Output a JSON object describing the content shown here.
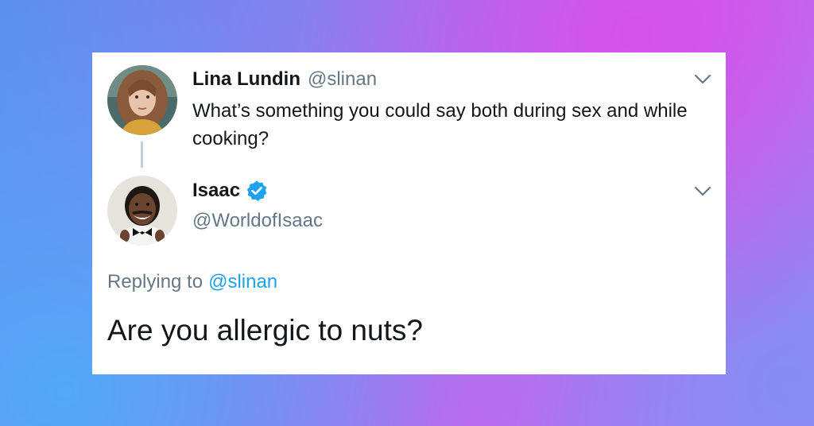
{
  "original_tweet": {
    "display_name": "Lina Lundin",
    "handle": "@slinan",
    "text": "What’s something you could say both during sex and while cooking?",
    "avatar_icon": "woman-portrait-avatar",
    "menu_icon": "chevron-down-icon"
  },
  "reply_tweet": {
    "display_name": "Isaac",
    "verified_icon": "verified-badge-icon",
    "handle": "@WorldofIsaac",
    "avatar_icon": "man-portrait-avatar",
    "menu_icon": "chevron-down-icon",
    "replying_label": "Replying to",
    "replying_to": "@slinan",
    "text": "Are you allergic to nuts?"
  },
  "colors": {
    "text_primary": "#14171a",
    "text_secondary": "#657786",
    "link": "#1da1f2",
    "verified": "#1da1f2",
    "thread_line": "#c4cfd6",
    "card_background": "#ffffff"
  }
}
